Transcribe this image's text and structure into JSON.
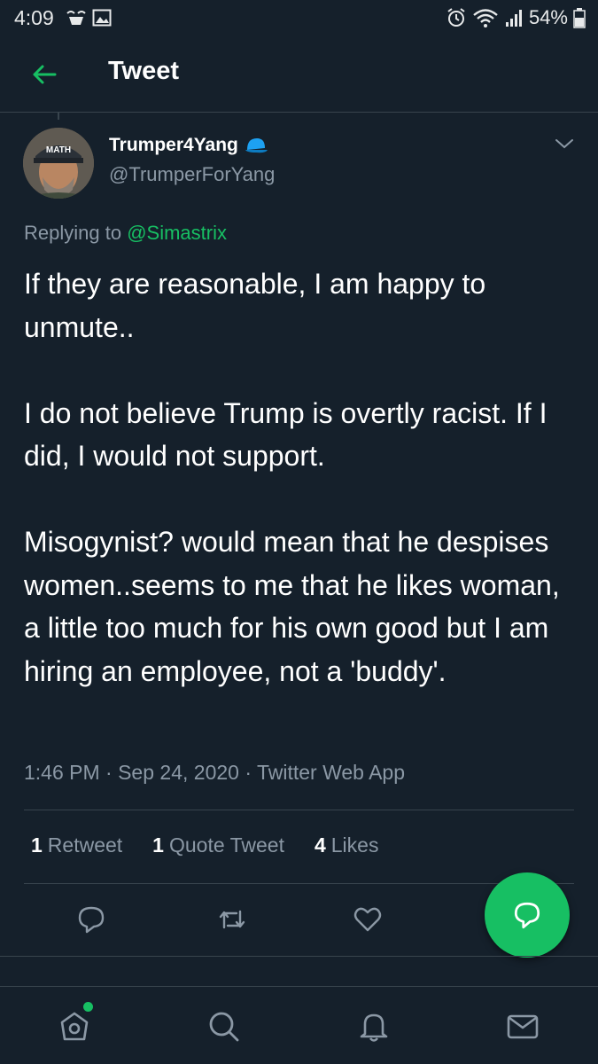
{
  "status_bar": {
    "time": "4:09",
    "battery": "54%",
    "icons": [
      "notification-app-icon",
      "gallery-icon",
      "alarm-icon",
      "wifi-icon",
      "signal-icon",
      "battery-icon"
    ]
  },
  "header": {
    "title": "Tweet",
    "back_icon": "back-arrow-icon"
  },
  "tweet": {
    "display_name": "Trumper4Yang",
    "handle": "@TrumperForYang",
    "avatar_cap_text": "MATH",
    "replying_to_prefix": "Replying to ",
    "replying_to_user": "@Simastrix",
    "paragraphs": [
      "If they are reasonable, I am happy to unmute..",
      "I do not believe Trump is overtly racist. If I did, I would not support.",
      "Misogynist? would mean that he despises women..seems to me that he likes woman, a little too much for his own good but I am hiring an employee, not a 'buddy'."
    ],
    "meta": "1:46 PM · Sep 24, 2020 · Twitter Web App",
    "stats": {
      "retweets_count": "1",
      "retweets_label": "Retweet",
      "quotes_count": "1",
      "quotes_label": "Quote Tweet",
      "likes_count": "4",
      "likes_label": "Likes"
    }
  },
  "actions": [
    "reply-icon",
    "retweet-icon",
    "like-icon",
    "compose-reply-icon"
  ],
  "bottom_nav": [
    "home-icon",
    "search-icon",
    "notifications-icon",
    "messages-icon"
  ],
  "colors": {
    "background": "#15202b",
    "accent": "#17bf63",
    "secondary_text": "#8b98a5",
    "divider": "#38444d"
  }
}
